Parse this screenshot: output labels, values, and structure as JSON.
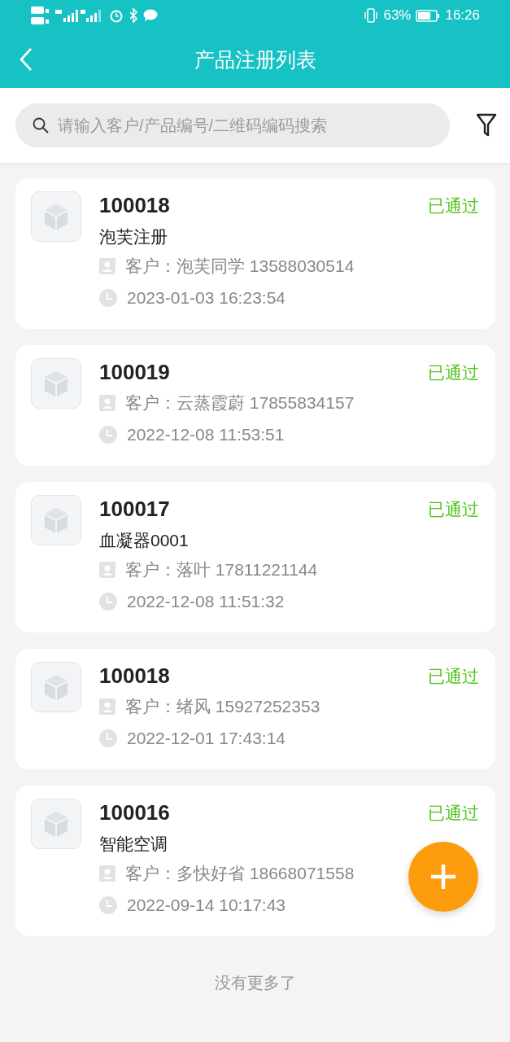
{
  "status_bar": {
    "battery": "63%",
    "time": "16:26"
  },
  "header": {
    "title": "产品注册列表"
  },
  "search": {
    "placeholder": "请输入客户/产品编号/二维码编码搜索"
  },
  "items": [
    {
      "number": "100018",
      "name": "泡芙注册",
      "customer": "客户：泡芙同学 13588030514",
      "time": "2023-01-03 16:23:54",
      "status": "已通过"
    },
    {
      "number": "100019",
      "customer": "客户：云蒸霞蔚 17855834157",
      "time": "2022-12-08 11:53:51",
      "status": "已通过"
    },
    {
      "number": "100017",
      "name": "血凝器0001",
      "customer": "客户：落叶 17811221144",
      "time": "2022-12-08 11:51:32",
      "status": "已通过"
    },
    {
      "number": "100018",
      "customer": "客户：绪风 15927252353",
      "time": "2022-12-01 17:43:14",
      "status": "已通过"
    },
    {
      "number": "100016",
      "name": "智能空调",
      "customer": "客户：多快好省 18668071558",
      "time": "2022-09-14 10:17:43",
      "status": "已通过"
    }
  ],
  "footer": "没有更多了"
}
